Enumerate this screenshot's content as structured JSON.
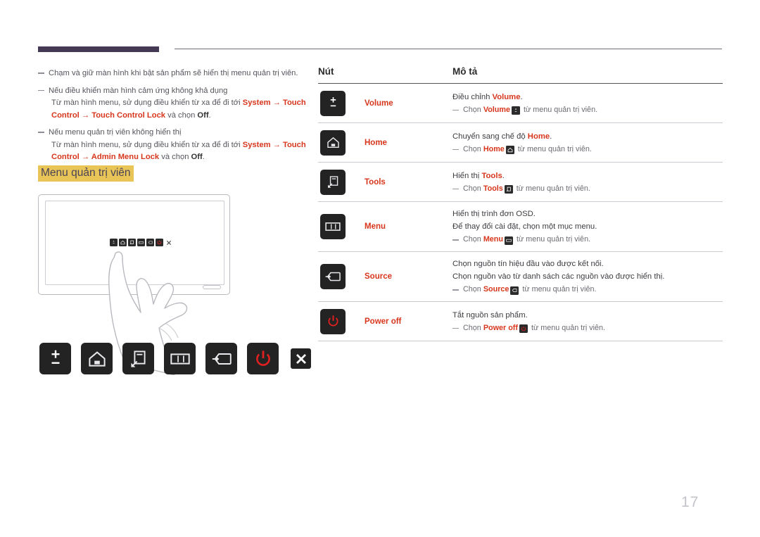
{
  "page": {
    "number": "17"
  },
  "notes": [
    {
      "main_pre": "Chạm và giữ màn hình khi bật sản phẩm sẽ hiển thị menu quản trị viên.",
      "sub": []
    },
    {
      "main_pre": "Nếu điều khiển màn hình cảm ứng không khả dụng",
      "sub": [
        {
          "pre": "Từ màn hình menu, sử dụng điều khiển từ xa để đi tới ",
          "b1": "System",
          "arrow1": " → ",
          "b2": "Touch Control",
          "arrow2": " → ",
          "b3": "Touch Control Lock",
          "mid": " và chọn ",
          "b4": "Off",
          "post": "."
        }
      ]
    },
    {
      "main_pre": "Nếu menu quản trị viên không hiển thị",
      "sub": [
        {
          "pre": "Từ màn hình menu, sử dụng điều khiển từ xa để đi tới ",
          "b1": "System",
          "arrow1": " → ",
          "b2": "Touch Control",
          "arrow2": " → ",
          "b3": "Admin Menu Lock",
          "mid": " và chọn ",
          "b4": "Off",
          "post": "."
        }
      ]
    }
  ],
  "section": {
    "heading": "Menu quản trị viên"
  },
  "illustration": {
    "alt": "Màn hình cảm ứng với ngón tay chạm vào thanh menu quản trị viên",
    "mini_buttons": [
      "volume-icon",
      "home-icon",
      "tools-icon",
      "menu-icon",
      "source-icon",
      "power-icon",
      "close-icon"
    ]
  },
  "button_row": [
    {
      "name": "volume-button",
      "icon": "volume-plus-minus-icon"
    },
    {
      "name": "home-button",
      "icon": "home-icon"
    },
    {
      "name": "tools-button",
      "icon": "tools-icon"
    },
    {
      "name": "menu-button",
      "icon": "menu-grid-icon"
    },
    {
      "name": "source-button",
      "icon": "source-arrow-icon"
    },
    {
      "name": "power-off-button",
      "icon": "power-icon"
    },
    {
      "name": "close-button",
      "icon": "close-x-icon"
    }
  ],
  "table": {
    "headers": {
      "button": "Nút",
      "description": "Mô tả"
    },
    "rows": [
      {
        "icon": "volume-plus-minus-icon",
        "name": "Volume",
        "lines": [
          {
            "pre": "Điều chỉnh ",
            "em": "Volume",
            "post": "."
          }
        ],
        "note": {
          "pre": "Chọn ",
          "em": "Volume",
          "badge": "volume-icon",
          "post": " từ menu quản trị viên."
        }
      },
      {
        "icon": "home-icon",
        "name": "Home",
        "lines": [
          {
            "pre": "Chuyển sang chế độ ",
            "em": "Home",
            "post": "."
          }
        ],
        "note": {
          "pre": "Chọn ",
          "em": "Home",
          "badge": "home-icon",
          "post": " từ menu quản trị viên."
        }
      },
      {
        "icon": "tools-icon",
        "name": "Tools",
        "lines": [
          {
            "pre": "Hiển thị ",
            "em": "Tools",
            "post": "."
          }
        ],
        "note": {
          "pre": "Chọn ",
          "em": "Tools",
          "badge": "tools-icon",
          "post": " từ menu quản trị viên."
        }
      },
      {
        "icon": "menu-grid-icon",
        "name": "Menu",
        "lines": [
          {
            "pre": "Hiển thị trình đơn OSD.",
            "em": "",
            "post": ""
          },
          {
            "pre": "Để thay đổi cài đặt, chọn một mục menu.",
            "em": "",
            "post": ""
          }
        ],
        "note": {
          "pre": "Chọn ",
          "em": "Menu",
          "badge": "menu-icon",
          "post": " từ menu quản trị viên."
        }
      },
      {
        "icon": "source-arrow-icon",
        "name": "Source",
        "lines": [
          {
            "pre": "Chọn nguồn tín hiệu đầu vào được kết nối.",
            "em": "",
            "post": ""
          },
          {
            "pre": "Chọn nguồn vào từ danh sách các nguồn vào được hiển thị.",
            "em": "",
            "post": ""
          }
        ],
        "note": {
          "pre": "Chọn ",
          "em": "Source",
          "badge": "source-icon",
          "post": " từ menu quản trị viên."
        }
      },
      {
        "icon": "power-icon",
        "name": "Power off",
        "lines": [
          {
            "pre": "Tắt nguồn sản phẩm.",
            "em": "",
            "post": ""
          }
        ],
        "note": {
          "pre": "Chọn ",
          "em": "Power off",
          "badge": "power-icon",
          "post": " từ menu quản trị viên."
        }
      }
    ]
  },
  "colors": {
    "accent_red": "#d8361c",
    "highlight_gold": "#e9c558",
    "rule_purple": "#453a55",
    "button_dark": "#232323",
    "power_red": "#e02020"
  }
}
